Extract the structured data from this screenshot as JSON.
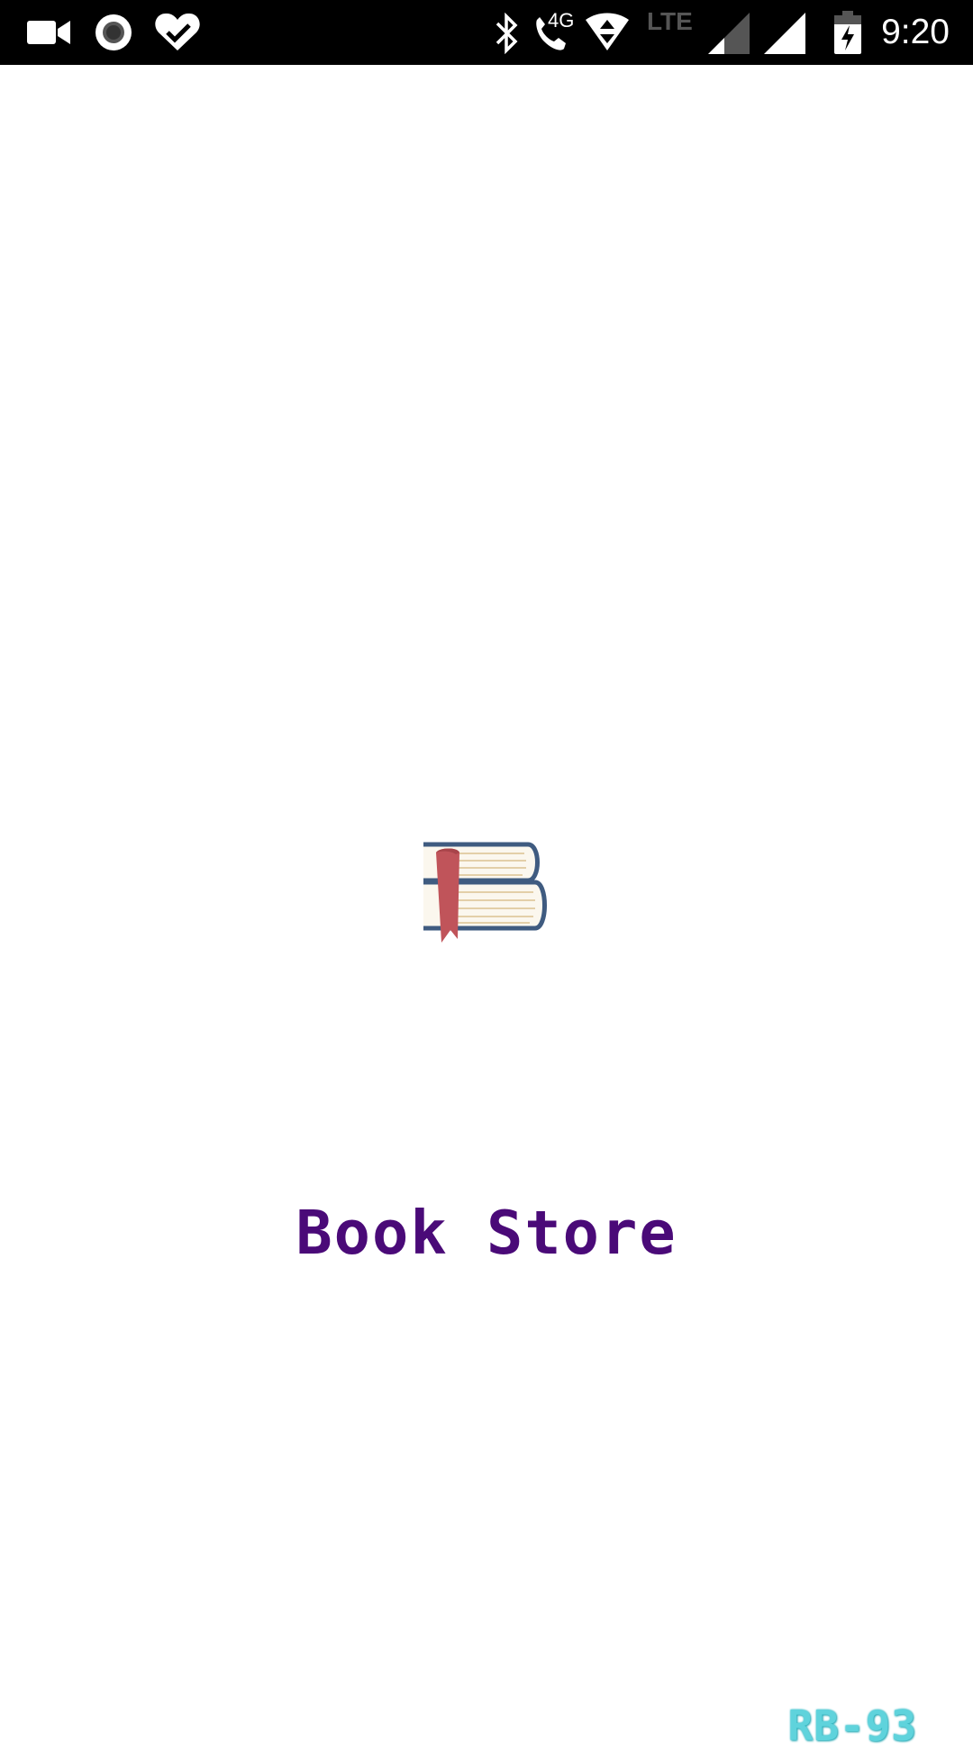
{
  "status_bar": {
    "time": "9:20",
    "network_label": "4G",
    "lte_label": "LTE",
    "icons": [
      "video-camera-icon",
      "record-icon",
      "heart-check-icon",
      "bluetooth-icon",
      "wifi-calling-icon",
      "data-arrows-icon",
      "signal-icon",
      "signal-full-icon",
      "battery-charging-icon"
    ]
  },
  "splash": {
    "title": "Book Store",
    "logo_icon": "books-stack-icon",
    "version": "RB-93"
  },
  "colors": {
    "title": "#4a0a78",
    "version": "#5fd3dc",
    "book_cover": "#3f5b80",
    "bookmark": "#c0545a",
    "pages": "#e9dcc3"
  }
}
